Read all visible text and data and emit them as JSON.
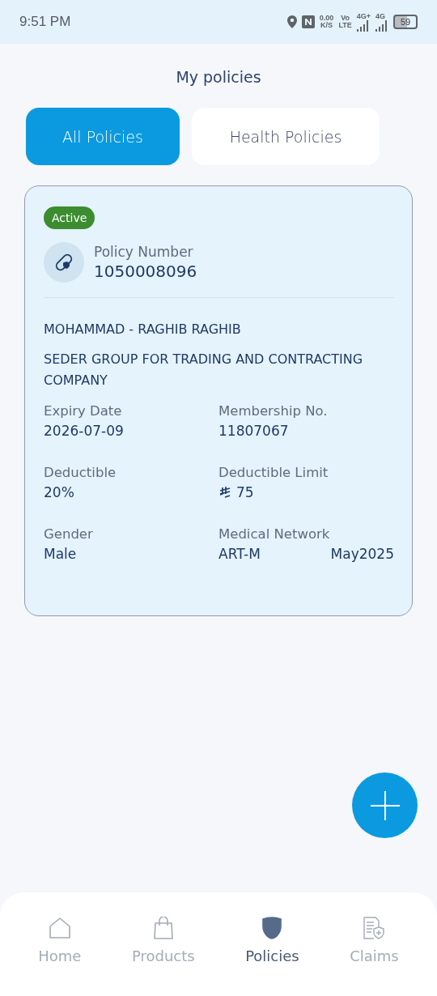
{
  "status_bar": {
    "time": "9:51 PM",
    "speed": "0.00",
    "speed_unit": "K/S",
    "volte_top": "Vo",
    "volte_bottom": "LTE",
    "network_1": "4G+",
    "network_2": "4G",
    "battery": "59"
  },
  "title": "My policies",
  "tabs": [
    {
      "label": "All Policies",
      "selected": true
    },
    {
      "label": "Health Policies",
      "selected": false
    }
  ],
  "policy": {
    "status": "Active",
    "number_label": "Policy Number",
    "number": "1050008096",
    "holder": "MOHAMMAD - RAGHIB RAGHIB",
    "company": "SEDER GROUP FOR TRADING AND CONTRACTING COMPANY",
    "fields": [
      {
        "label": "Expiry Date",
        "values": [
          "2026-07-09"
        ]
      },
      {
        "label": "Membership No.",
        "values": [
          "11807067"
        ]
      },
      {
        "label": "Deductible",
        "values": [
          "20%"
        ]
      },
      {
        "label": "Deductible Limit",
        "values": [
          "75"
        ],
        "currency": true
      },
      {
        "label": "Gender",
        "values": [
          "Male"
        ]
      },
      {
        "label": "Medical Network",
        "values": [
          "ART-M",
          "May2025"
        ]
      }
    ]
  },
  "nav": [
    {
      "kind": "home",
      "label": "Home",
      "selected": false
    },
    {
      "kind": "bag",
      "label": "Products",
      "selected": false
    },
    {
      "kind": "shield",
      "label": "Policies",
      "selected": true
    },
    {
      "kind": "claim",
      "label": "Claims",
      "selected": false
    }
  ]
}
